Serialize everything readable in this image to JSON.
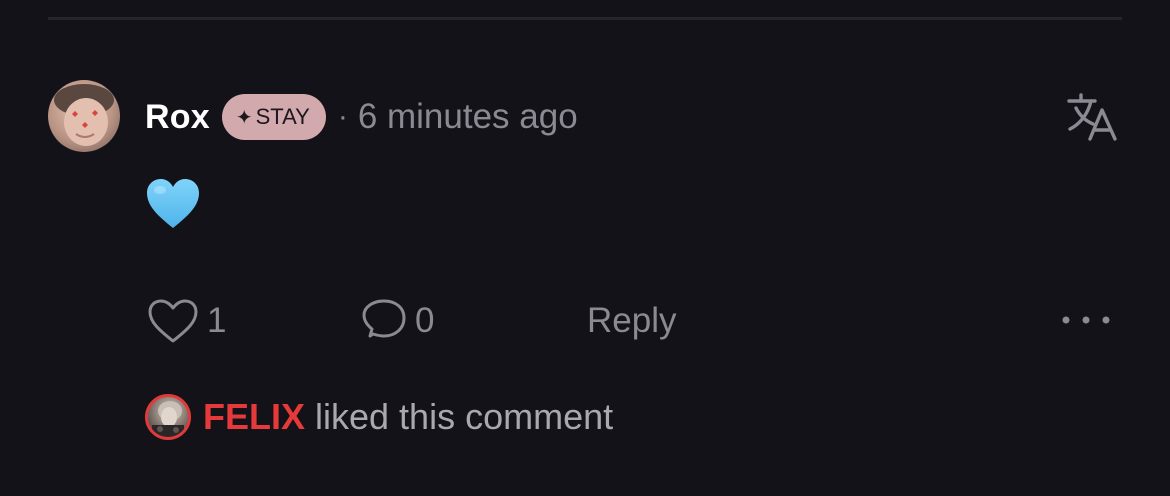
{
  "comment": {
    "username": "Rox",
    "badge_symbol": "✦",
    "badge_label": "STAY",
    "separator": "·",
    "timestamp": "6 minutes ago",
    "body_emoji": "light-blue-heart-emoji"
  },
  "actions": {
    "like_count": "1",
    "comment_count": "0",
    "reply_label": "Reply"
  },
  "liked_by": {
    "name": "FELIX",
    "text": "liked this comment"
  },
  "icons": {
    "translate": "translate-icon",
    "like": "heart-outline-icon",
    "comment": "speech-bubble-icon",
    "more": "more-dots-icon"
  },
  "colors": {
    "background": "#131218",
    "badge": "#d2a9ad",
    "liker_accent": "#e5393a",
    "heart_emoji": "#62c3f2"
  }
}
